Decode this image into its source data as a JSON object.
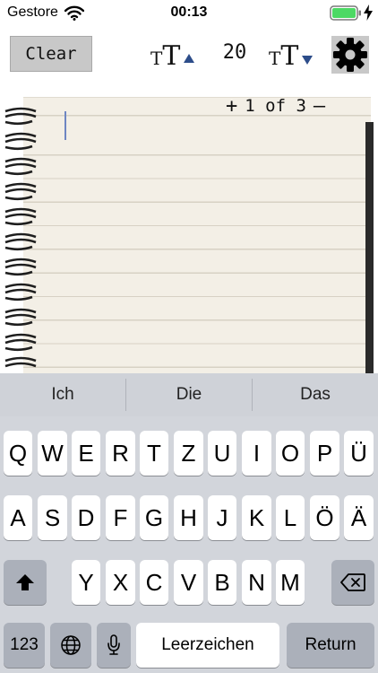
{
  "status": {
    "carrier": "Gestore",
    "time": "00:13"
  },
  "toolbar": {
    "clear_label": "Clear",
    "font_size": "20",
    "tt_small": "T",
    "tt_large": "T"
  },
  "page": {
    "plus": "+",
    "indicator": "1 of 3",
    "minus": "–"
  },
  "suggestions": [
    "Ich",
    "Die",
    "Das"
  ],
  "keyboard": {
    "row1": [
      "Q",
      "W",
      "E",
      "R",
      "T",
      "Z",
      "U",
      "I",
      "O",
      "P",
      "Ü"
    ],
    "row2": [
      "A",
      "S",
      "D",
      "F",
      "G",
      "H",
      "J",
      "K",
      "L",
      "Ö",
      "Ä"
    ],
    "row3": [
      "Y",
      "X",
      "C",
      "V",
      "B",
      "N",
      "M"
    ],
    "numbers_label": "123",
    "space_label": "Leerzeichen",
    "return_label": "Return"
  },
  "icons": {
    "wifi": "wifi-icon",
    "battery": "battery-icon",
    "charging": "charging-bolt-icon",
    "font_increase": "text-size-increase-icon",
    "font_decrease": "text-size-decrease-icon",
    "settings": "gear-icon",
    "shift": "shift-icon",
    "delete": "backspace-icon",
    "globe": "globe-icon",
    "mic": "microphone-icon"
  },
  "colors": {
    "battery": "#4cd964",
    "arrow": "#2d4d8a",
    "cursor": "#6e86c2",
    "keyboard_bg": "#d2d5db"
  }
}
